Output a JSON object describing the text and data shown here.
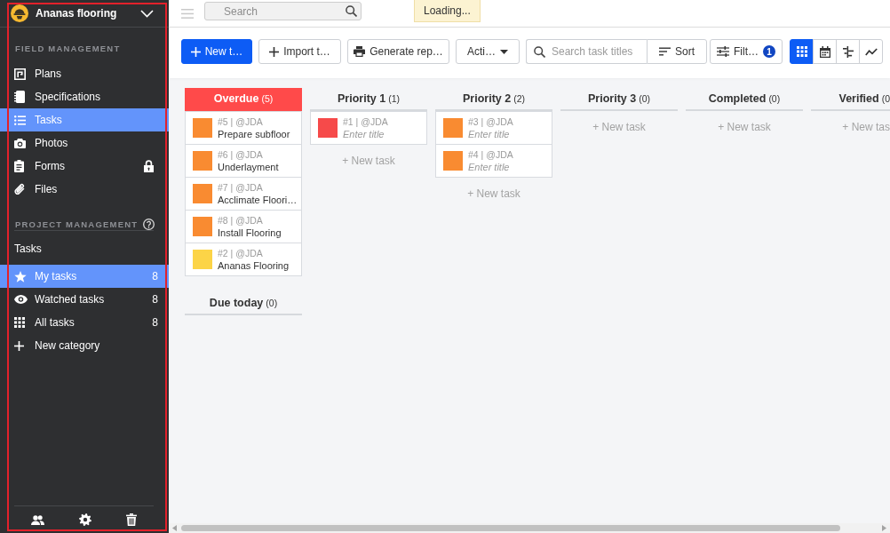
{
  "sidebar": {
    "project": "Ananas flooring",
    "sections": [
      {
        "title": "FIELD MANAGEMENT",
        "help": false,
        "items": [
          {
            "label": "Plans",
            "selected": false,
            "locked": false
          },
          {
            "label": "Specifications",
            "selected": false,
            "locked": false
          },
          {
            "label": "Tasks",
            "selected": true,
            "locked": false
          },
          {
            "label": "Photos",
            "selected": false,
            "locked": false
          },
          {
            "label": "Forms",
            "selected": false,
            "locked": true
          },
          {
            "label": "Files",
            "selected": false,
            "locked": false
          }
        ]
      },
      {
        "title": "PROJECT MANAGEMENT",
        "help": true
      }
    ],
    "task_lists": {
      "title": "Tasks",
      "items": [
        {
          "kind": "list",
          "label": "My tasks",
          "count": "8",
          "selected": true
        },
        {
          "kind": "list",
          "label": "Watched tasks",
          "count": "8",
          "selected": false
        },
        {
          "kind": "list",
          "label": "All tasks",
          "count": "8",
          "selected": false
        },
        {
          "kind": "add",
          "label": "New category",
          "selected": false
        }
      ]
    }
  },
  "topbar": {
    "search": {
      "placeholder": "Search"
    },
    "notice": "Loading..."
  },
  "toolbar": {
    "buttons": [
      {
        "kind": "primary",
        "label": "New t…"
      },
      {
        "kind": "add",
        "label": "Import t…"
      },
      {
        "kind": "print",
        "label": "Generate rep…"
      },
      {
        "kind": "menu",
        "label": "Acti…"
      }
    ],
    "task_search": {
      "placeholder": "Search task titles"
    },
    "sort_button": "Sort",
    "filter_button": {
      "label": "Filt…",
      "badge": "1"
    },
    "views": [
      {
        "selected": true
      },
      {
        "selected": false
      },
      {
        "selected": false
      },
      {
        "selected": false
      }
    ]
  },
  "board": {
    "columns": [
      {
        "groups": [
          {
            "title": "Overdue",
            "count": "(5)",
            "alert": true,
            "tasks": [
              {
                "ref": "#5 | @JDA",
                "title": "Prepare subfloor",
                "color": "#f98b31"
              },
              {
                "ref": "#6 | @JDA",
                "title": "Underlayment",
                "color": "#f98b31"
              },
              {
                "ref": "#7 | @JDA",
                "title": "Acclimate Floori…",
                "color": "#f98b31"
              },
              {
                "ref": "#8 | @JDA",
                "title": "Install Flooring",
                "color": "#f98b31"
              },
              {
                "ref": "#2 | @JDA",
                "title": "Ananas Flooring",
                "color": "#fcd447"
              }
            ]
          },
          {
            "title": "Due today",
            "count": "(0)",
            "alert": false
          }
        ]
      },
      {
        "groups": [
          {
            "title": "Priority 1",
            "count": "(1)",
            "alert": false,
            "tasks": [
              {
                "ref": "#1 | @JDA",
                "placeholder": "Enter title",
                "color": "#f64a4a"
              }
            ],
            "new_task": "+ New task"
          }
        ]
      },
      {
        "groups": [
          {
            "title": "Priority 2",
            "count": "(2)",
            "alert": false,
            "tasks": [
              {
                "ref": "#3 | @JDA",
                "placeholder": "Enter title",
                "color": "#f98b31"
              },
              {
                "ref": "#4 | @JDA",
                "placeholder": "Enter title",
                "color": "#f98b31"
              }
            ],
            "new_task": "+ New task"
          }
        ]
      },
      {
        "groups": [
          {
            "title": "Priority 3",
            "count": "(0)",
            "alert": false,
            "new_task": "+ New task"
          }
        ]
      },
      {
        "groups": [
          {
            "title": "Completed",
            "count": "(0)",
            "alert": false,
            "new_task": "+ New task"
          }
        ]
      },
      {
        "groups": [
          {
            "title": "Verified",
            "count": "(0",
            "alert": false,
            "new_task": "+ New tas"
          }
        ]
      }
    ]
  }
}
